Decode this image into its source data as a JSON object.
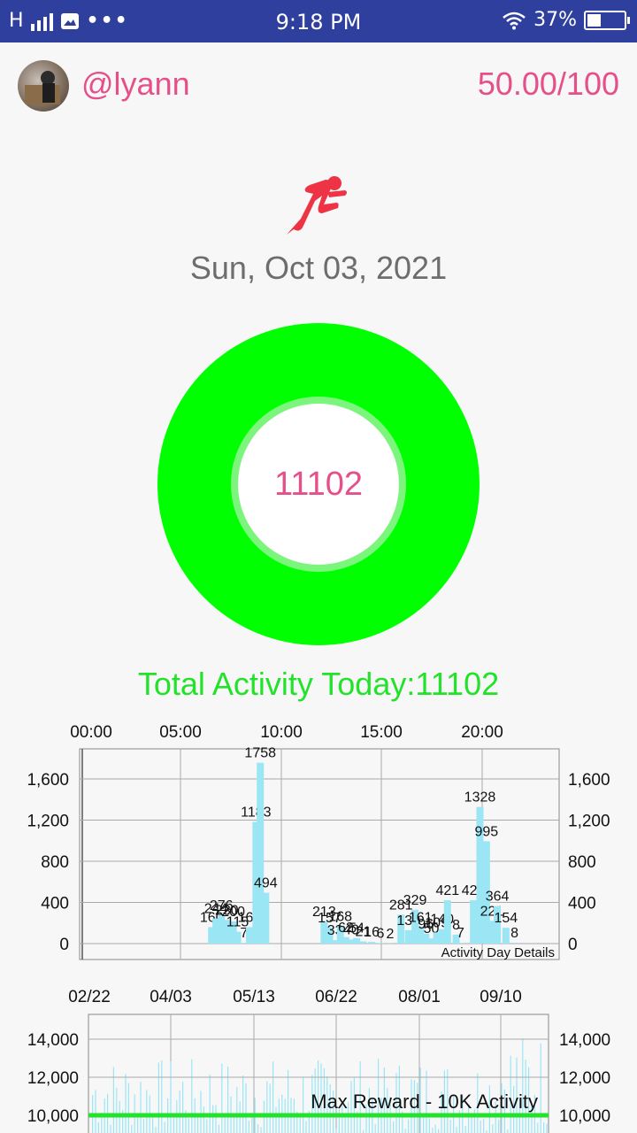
{
  "status_bar": {
    "network": "H",
    "time": "9:18 PM",
    "battery": "37%",
    "battery_level": 0.37
  },
  "header": {
    "username": "@lyann",
    "score": "50.00/100"
  },
  "activity_icon": "running-person-icon",
  "date": "Sun, Oct 03, 2021",
  "ring_value": "11102",
  "total_label": "Total Activity Today:11102",
  "colors": {
    "accent_pink": "#e6508a",
    "ring_green": "#00ff00",
    "text_green": "#22e22a",
    "bar_blue": "#9ae6f5",
    "status_bar": "#2f3f9e"
  },
  "chart_data": [
    {
      "type": "bar",
      "x_axis_top_labels": [
        "00:00",
        "05:00",
        "10:00",
        "15:00",
        "20:00"
      ],
      "y_ticks": [
        "1,600",
        "1,200",
        "800",
        "400",
        "0"
      ],
      "ylim": [
        0,
        1850
      ],
      "xlim": [
        0,
        24
      ],
      "description_label": "Activity Day Details",
      "bars": [
        {
          "x": 6.1,
          "y": 160,
          "label": "160"
        },
        {
          "x": 6.3,
          "y": 244,
          "label": "244"
        },
        {
          "x": 6.55,
          "y": 276,
          "label": "276"
        },
        {
          "x": 6.8,
          "y": 230,
          "label": "230"
        },
        {
          "x": 7.1,
          "y": 215,
          "label": "200"
        },
        {
          "x": 7.3,
          "y": 115,
          "label": "115"
        },
        {
          "x": 7.6,
          "y": 7,
          "label": "7"
        },
        {
          "x": 7.85,
          "y": 160,
          "label": "160"
        },
        {
          "x": 8.15,
          "y": 1183,
          "label": "1183"
        },
        {
          "x": 8.35,
          "y": 1758,
          "label": "1758"
        },
        {
          "x": 8.6,
          "y": 494,
          "label": "494"
        },
        {
          "x": 11.3,
          "y": 213,
          "label": "213"
        },
        {
          "x": 11.55,
          "y": 157,
          "label": "157"
        },
        {
          "x": 11.8,
          "y": 33,
          "label": "33"
        },
        {
          "x": 12.05,
          "y": 168,
          "label": "168"
        },
        {
          "x": 12.3,
          "y": 62,
          "label": "62"
        },
        {
          "x": 12.55,
          "y": 40,
          "label": "40"
        },
        {
          "x": 12.8,
          "y": 54,
          "label": "54"
        },
        {
          "x": 13.1,
          "y": 21,
          "label": "21"
        },
        {
          "x": 13.5,
          "y": 16,
          "label": "16"
        },
        {
          "x": 13.9,
          "y": 6,
          "label": "6"
        },
        {
          "x": 14.35,
          "y": 2,
          "label": "2"
        },
        {
          "x": 14.85,
          "y": 281,
          "label": "281"
        },
        {
          "x": 15.2,
          "y": 130,
          "label": "130"
        },
        {
          "x": 15.5,
          "y": 329,
          "label": "329"
        },
        {
          "x": 15.75,
          "y": 161,
          "label": "161"
        },
        {
          "x": 16.0,
          "y": 96,
          "label": "96"
        },
        {
          "x": 16.25,
          "y": 50,
          "label": "50"
        },
        {
          "x": 16.5,
          "y": 109,
          "label": "109"
        },
        {
          "x": 16.75,
          "y": 141,
          "label": "140"
        },
        {
          "x": 17.0,
          "y": 421,
          "label": "421"
        },
        {
          "x": 17.4,
          "y": 87,
          "label": "8"
        },
        {
          "x": 17.6,
          "y": 7,
          "label": "7"
        },
        {
          "x": 18.2,
          "y": 421,
          "label": "421"
        },
        {
          "x": 18.5,
          "y": 1328,
          "label": "1328"
        },
        {
          "x": 18.8,
          "y": 995,
          "label": "995"
        },
        {
          "x": 19.05,
          "y": 221,
          "label": "221"
        },
        {
          "x": 19.3,
          "y": 364,
          "label": "364"
        },
        {
          "x": 19.7,
          "y": 154,
          "label": "154"
        },
        {
          "x": 20.1,
          "y": 8,
          "label": "8"
        }
      ]
    },
    {
      "type": "bar",
      "x_axis_top_labels": [
        "02/22",
        "04/03",
        "05/13",
        "06/22",
        "08/01",
        "09/10"
      ],
      "y_ticks": [
        "14,000",
        "12,000",
        "10,000"
      ],
      "ylim": [
        9000,
        15000
      ],
      "reference_line": {
        "value": 10000,
        "label": "Max Reward - 10K Activity"
      }
    }
  ]
}
